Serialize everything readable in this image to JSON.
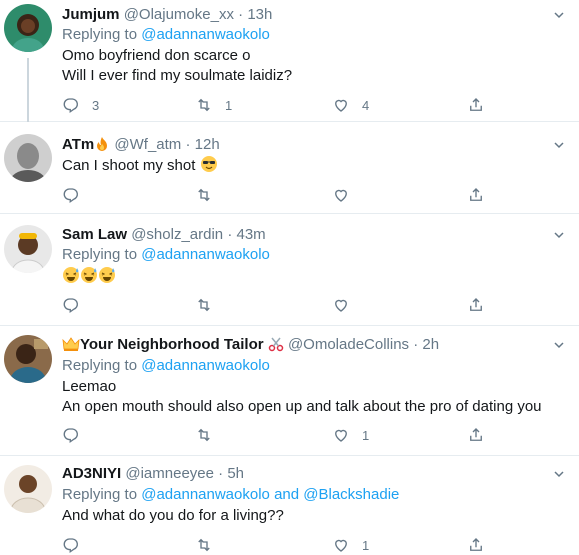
{
  "tweets": [
    {
      "name": "Jumjum",
      "handle": "@Olajumoke_xx",
      "time": "13h",
      "replying_prefix": "Replying to",
      "replying_to": [
        "@adannanwaokolo"
      ],
      "lines": [
        "Omo boyfriend don scarce o",
        "Will I ever find my soulmate laidiz?"
      ],
      "reply_count": "3",
      "retweet_count": "1",
      "like_count": "4"
    },
    {
      "name": "ATm",
      "handle": "@Wf_atm",
      "time": "12h",
      "lines": [
        "Can I shoot my shot"
      ],
      "reply_count": "",
      "retweet_count": "",
      "like_count": ""
    },
    {
      "name": "Sam Law",
      "handle": "@sholz_ardin",
      "time": "43m",
      "replying_prefix": "Replying to",
      "replying_to": [
        "@adannanwaokolo"
      ],
      "lines": [],
      "reply_count": "",
      "retweet_count": "",
      "like_count": ""
    },
    {
      "name": "Your Neighborhood Tailor",
      "handle": "@OmoladeCollins",
      "time": "2h",
      "replying_prefix": "Replying to",
      "replying_to": [
        "@adannanwaokolo"
      ],
      "lines": [
        "Leemao",
        "An open mouth should also open up and talk about the pro of dating you"
      ],
      "reply_count": "",
      "retweet_count": "",
      "like_count": "1"
    },
    {
      "name": "AD3NIYI",
      "handle": "@iamneeyee",
      "time": "5h",
      "replying_prefix": "Replying to",
      "replying_to": [
        "@adannanwaokolo",
        "@Blackshadie"
      ],
      "replying_joiner": "and",
      "lines": [
        "And what do you do for a living??"
      ],
      "reply_count": "",
      "retweet_count": "",
      "like_count": "1"
    }
  ],
  "separator_dot": "·",
  "icons": {
    "reply": "reply-icon",
    "retweet": "retweet-icon",
    "like": "heart-icon",
    "share": "share-icon",
    "caret": "chevron-down-icon",
    "fire": "fire-emoji",
    "sunglasses": "sunglasses-emoji",
    "sweat_smile": "sweat-smile-emoji",
    "crown": "crown-emoji",
    "scissors": "scissors-emoji"
  },
  "colors": {
    "link": "#1da1f2",
    "muted": "#657786",
    "text": "#14171a",
    "divider": "#e6ecf0"
  }
}
